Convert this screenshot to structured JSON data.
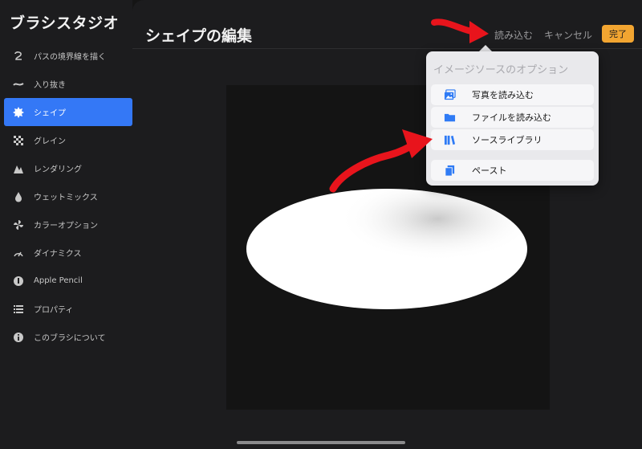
{
  "app": {
    "title": "ブラシスタジオ"
  },
  "sidebar": {
    "items": [
      {
        "label": "パスの境界線を描く",
        "icon": "stroke-path-icon",
        "active": false
      },
      {
        "label": "入り抜き",
        "icon": "taper-icon",
        "active": false
      },
      {
        "label": "シェイプ",
        "icon": "shape-icon",
        "active": true
      },
      {
        "label": "グレイン",
        "icon": "grain-icon",
        "active": false
      },
      {
        "label": "レンダリング",
        "icon": "rendering-icon",
        "active": false
      },
      {
        "label": "ウェットミックス",
        "icon": "wet-mix-icon",
        "active": false
      },
      {
        "label": "カラーオプション",
        "icon": "color-options-icon",
        "active": false
      },
      {
        "label": "ダイナミクス",
        "icon": "dynamics-icon",
        "active": false
      },
      {
        "label": "Apple Pencil",
        "icon": "apple-pencil-icon",
        "active": false
      },
      {
        "label": "プロパティ",
        "icon": "properties-icon",
        "active": false
      },
      {
        "label": "このブラシについて",
        "icon": "info-icon",
        "active": false
      }
    ]
  },
  "header": {
    "title": "シェイプの編集",
    "import_label": "読み込む",
    "cancel_label": "キャンセル",
    "done_label": "完了"
  },
  "popover": {
    "title": "イメージソースのオプション",
    "items": [
      {
        "label": "写真を読み込む",
        "icon": "photo-icon"
      },
      {
        "label": "ファイルを読み込む",
        "icon": "folder-icon"
      },
      {
        "label": "ソースライブラリ",
        "icon": "library-icon"
      },
      {
        "label": "ペースト",
        "icon": "paste-icon"
      }
    ]
  },
  "colors": {
    "accent": "#3478f6",
    "done_button": "#f2a531",
    "annotation_arrow": "#e8141c"
  }
}
